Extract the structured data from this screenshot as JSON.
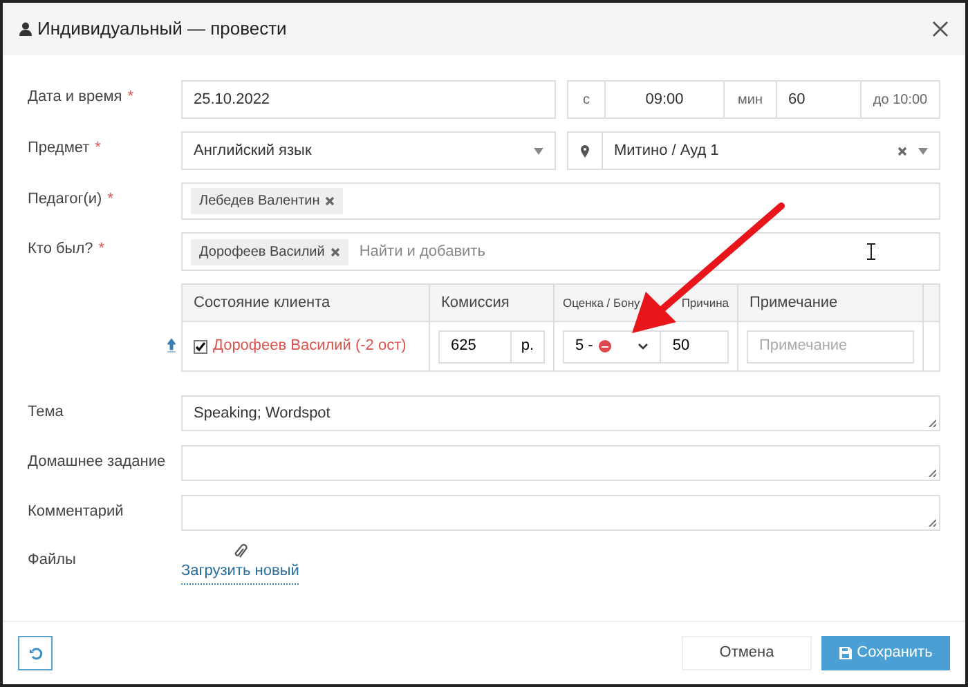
{
  "window": {
    "title": "Индивидуальный — провести"
  },
  "datetime": {
    "label": "Дата и время",
    "required_mark": "*",
    "date": "25.10.2022",
    "from_label": "с",
    "from": "09:00",
    "duration_label": "мин",
    "duration": "60",
    "until": "до 10:00"
  },
  "subject": {
    "label": "Предмет",
    "required_mark": "*",
    "value": "Английский язык",
    "location": "Митино / Ауд 1"
  },
  "teachers": {
    "label": "Педагог(и)",
    "required_mark": "*",
    "tags": [
      "Лебедев Валентин"
    ]
  },
  "attendees": {
    "label": "Кто был?",
    "required_mark": "*",
    "tags": [
      "Дорофеев Василий"
    ],
    "placeholder": "Найти и добавить"
  },
  "table": {
    "columns": [
      "Состояние клиента",
      "Комиссия",
      "Оценка / Бону",
      "Причина",
      "Примечание"
    ],
    "rows": [
      {
        "checked": true,
        "client": "Дорофеев Василий (-2 ост)",
        "commission": "625",
        "currency": "р.",
        "grade": "5 -",
        "bonus": "50",
        "note_placeholder": "Примечание"
      }
    ]
  },
  "fields": [
    {
      "label": "Тема",
      "value": "Speaking; Wordspot"
    },
    {
      "label": "Домашнее задание"
    },
    {
      "label": "Комментарий"
    }
  ],
  "files": {
    "label": "Файлы",
    "link": "Загрузить новый"
  },
  "buttons": {
    "cancel": "Отмена",
    "save": "Сохранить"
  }
}
